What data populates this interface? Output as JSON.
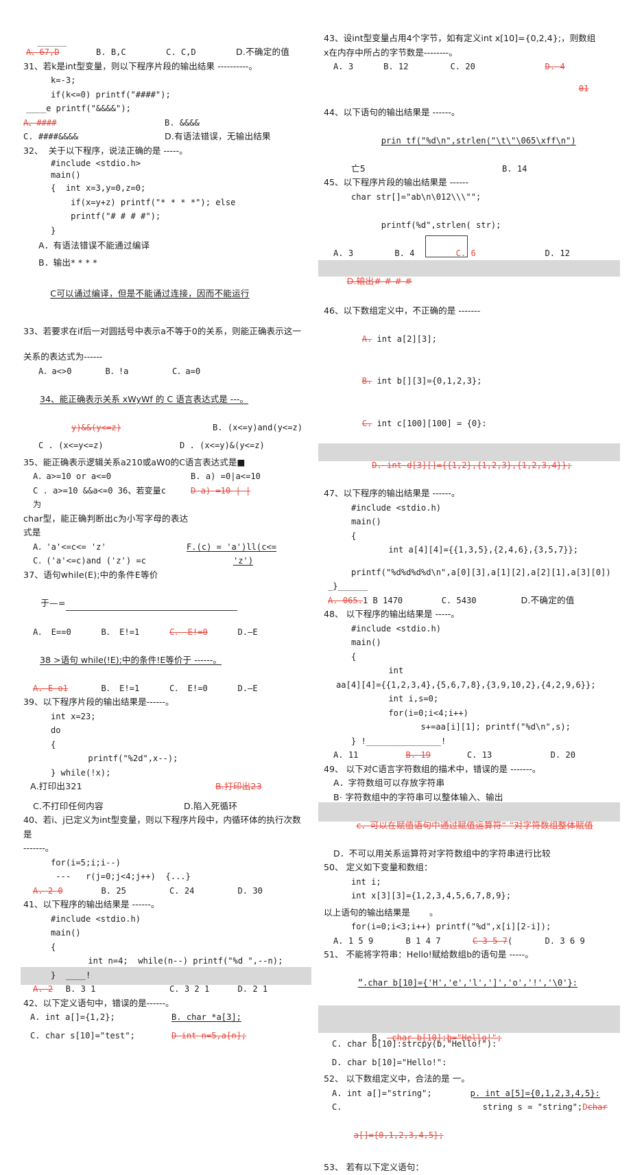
{
  "document": {
    "kind": "scanned-exam-paper",
    "language": "zh-CN",
    "subject": "C 语言程序设计 选择题",
    "accent_red": "#e8463c",
    "highlight_gray": "#c9c9c9"
  },
  "left_column": {
    "q30_tail": {
      "blank_mark": "______",
      "options": [
        "A、67,D",
        "B. B,C",
        "C. C,D",
        "D.不确定的值"
      ]
    },
    "q31": {
      "stem": "31、若k是int型变量，则以下程序片段的输出结果 ----------。",
      "code": [
        "k=-3;",
        "if(k<=0) printf(\"####\");",
        "____e printf(\"&&&&\");"
      ],
      "options_row1": [
        "A、####",
        "B.  &&&&"
      ],
      "options_row2": [
        "C.  ####&&&&",
        "D.有语法错误，无输出结果"
      ]
    },
    "q32": {
      "stem": "32、  关于以下程序，说法正确的是 -----。",
      "code": [
        "#include <stdio.h>",
        "main()",
        "{  int x=3,y=0,z=0;",
        "    if(x=y+z) printf(\"* * * *\"); else",
        "    printf(\"# # # #\");",
        "}"
      ],
      "options": [
        "A．有语法错误不能通过编译",
        "B．输出* * * *",
        "C可以诵过编译，但是不能诵过连接，因而不能运行"
      ]
    },
    "q33": {
      "stem_line1": "33、若要求在if后一对圆括号中表示a不等于0的关系，则能正确表示这一",
      "stem_line2": "关系的表达式为------",
      "options": [
        "A．a<>0",
        "B．!a",
        "C．a=0"
      ]
    },
    "q34": {
      "stem": "34、能正确表示关系 xWyWf 的 C 语言表达式是 ---。",
      "optA": "y)&&(y<=z)",
      "optB": "B.  (x<=y)and(y<=z)",
      "optC": "C .  (x<=y<=z)",
      "optD": "D .  (x<=y)&(y<=z)"
    },
    "q35": {
      "stem": "35、能正确表示逻辑关系a210或aW0的C语言表达式是■",
      "optA": "A．a>=10 or a<=0",
      "optB": "B. a) =0|a<=10",
      "optC": "C . a>=10 &&a<=0  36、若变量c为",
      "optD": "D a) =10  | |",
      "cont1": "char型，能正确判断出c为小写字母的表达",
      "cont2": "式是",
      "optA2": "A．'a'<=c<= 'z'",
      "optC2": "C．('a'<=c)and ('z') =c",
      "optF": "F.(c) =  'a')ll(c<=",
      "optF2": "'z')"
    },
    "q37": {
      "stem1": "37、语句while(E);中的条件E等价",
      "stem2": "于—=",
      "options": [
        "A．  E==0",
        "B．  E!=1",
        "C．   E!=0",
        "D.—E"
      ]
    },
    "q38": {
      "stem": "38 >语句 while(!E);中的条件!E等价于 ------。",
      "options": [
        "A.   E—o1",
        "B．  E!=1",
        "C．  E!=0",
        "D.—E"
      ]
    },
    "q39": {
      "stem": "39、以下程序片段的输出结果是------。",
      "code": [
        "int x=23;",
        "do",
        "{",
        "     printf(\"%2d\",x--);",
        "} while(!x);"
      ],
      "optA": "A.打印出321",
      "optB": "B.打印出23",
      "optC": "C.不打印任何内容",
      "optD": "D.陷入死循环"
    },
    "q40": {
      "stem1": "40、若i、j已定义为int型变量，则以下程序片段中，内循环体的执行次数 是",
      "stem2": "-------。",
      "code": [
        "for(i=5;i;i--)",
        " ---   r(j=0;j<4;j++)  {...}"
      ],
      "options": [
        "A. 2 0",
        "B. 25",
        "C. 24",
        "D. 30"
      ]
    },
    "q41": {
      "stem": "41、以下程序的输出结果是 ------。",
      "code": [
        "#include <stdio.h)",
        "main()",
        "{",
        "     int n=4;  while(n--) printf(\"%d \",--n);"
      ],
      "code_banded": "}  ____!",
      "options": [
        "A. 2",
        "B. 3 1",
        "C. 3 2 1",
        "D. 2 1"
      ]
    },
    "q42": {
      "stem": "42、以下定义语句中，错误的是------。",
      "optA": "A. int a[]={1,2};",
      "optB": "B. char *a[3];",
      "optC": "C. char s[10]=\"test\";",
      "optD": "D int n=5,a[n];"
    }
  },
  "right_column": {
    "q43": {
      "stem1": "43、设int型变量占用4个字节，如有定义int x[10]={0,2,4};，则数组",
      "stem2": "x在内存中所占的字节数是--------。",
      "options": [
        "A. 3",
        "B. 12",
        "C. 20",
        "D. 4"
      ],
      "optD_second": "01"
    },
    "q44": {
      "stem": "44、以下语句的输出结果是 ------。",
      "code": "prin tf(\"%d\\n\",strlen(\"\\t\\\"\\065\\xff\\n\")",
      "optA": "亡5",
      "optB": "B. 14"
    },
    "q45": {
      "stem": "45、以下程序片段的输出结果是 ------",
      "code": [
        "char str[]=\"ab\\n\\012\\\\\\\"\";",
        "printf(%d\",strlen( str);"
      ],
      "options": [
        "A. 3",
        "B. 4",
        "C. 6",
        "D. 12"
      ],
      "banded_note": "D.输出# # # #"
    },
    "q46": {
      "stem": "46、以下数组定义中，不正确的是 -------",
      "optA": "A. int a[2][3];",
      "optB": "B. int b[][3]={0,1,2,3};",
      "optC": "C. int c[100][100] = {0}:",
      "optD": "D. int d[3][]={{1,2},{1,2,3},{1,2,3,4}};"
    },
    "q47": {
      "stem": "47、以下程序的输出结果是 ------。",
      "code": [
        "#include <stdio.h)",
        "main()",
        "{",
        "     int a[4][4]={{1,3,5},{2,4,6},{3,5,7}};",
        "printf(\"%d%d%d%d\\n\",a[0][3],a[1][2],a[2][1],a[3][0])",
        "_}______"
      ],
      "options": [
        "A. 065. 1 B 1470",
        "C. 5430",
        "D.不确定的值"
      ]
    },
    "q48": {
      "stem": "48、 以下程序的输出结果是 -----。",
      "code": [
        "#include <stdio.h)",
        "main()",
        "{",
        "     int",
        "aa[4][4]={{1,2,3,4},{5,6,7,8},{3,9,10,2},{4,2,9,6}};",
        "     int i,s=0;",
        "     for(i=0;i<4;i++)",
        "         s+=aa[i][1]; printf(\"%d\\n\",s);",
        "} !_______________!"
      ],
      "options": [
        "A. 11",
        "B. 19",
        "C. 13",
        "D. 20"
      ]
    },
    "q49": {
      "stem": "49、 以下对C语言字符数组的描术中，错误的是 -------。",
      "optA": "A．字符数组可以存放字符串",
      "optB": "B· 字符数组中的字符串可以整体输入、输出",
      "optC": "c．可以在赋值语句中通过赋值运算符“-”对字符数组整体赋值",
      "optD": "D．不可以用关系运算符对字符数组中的字符串进行比较"
    },
    "q50": {
      "stem": "50、 定义如下变量和数组：",
      "code": [
        "int i;",
        "int x[3][3]={1,2,3,4,5,6,7,8,9};"
      ],
      "stem2": "以上语句的输出结果是       。",
      "code2": "for(i=0;i<3;i++) printf(\"%d\",x[i][2-i]);",
      "options": [
        "A. 1 5 9",
        "B 1 4 7",
        "C 3 5 7",
        "D. 3 6 9"
      ]
    },
    "q51": {
      "stem": "51、 不能将字符串：Hello!赋给数组b的语句是 -----。",
      "optA": "”.char b[10]={'H','e','l',']','o','!','\\0'}:",
      "optB": "B.  char b[10];b=\"Hello!\";",
      "optC": "C. char b[10]:strcpy(b,\"Hello!\"):",
      "optD": "D. char b[10]=\"Hello!\":"
    },
    "q52": {
      "stem": "52、 以下数组定义中，合法的是 一。",
      "optA": "A. int a[]=\"string\";",
      "optB": "p. int a[5]={0,1,2,3,4,5}:",
      "optC": "C.",
      "optC2": "string s = \"string\";",
      "optD_lead": "D",
      "optD": "char",
      "optD2": "a[]={0,1,2,3,4,5};"
    },
    "q53": {
      "stem": "53、 若有以下定义语句："
    }
  }
}
